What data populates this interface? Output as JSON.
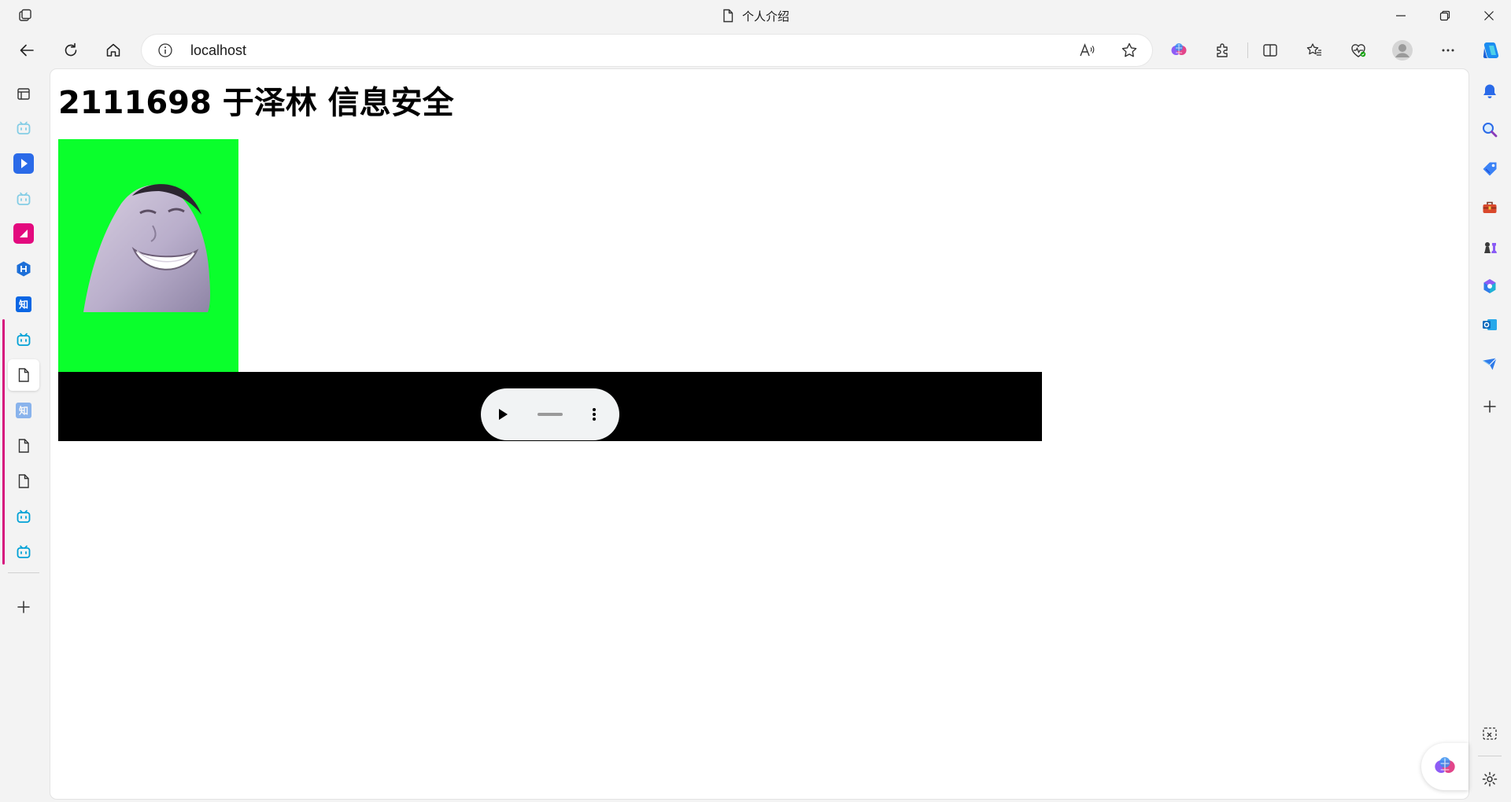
{
  "window": {
    "title": "个人介绍"
  },
  "address_bar": {
    "url": "localhost"
  },
  "page": {
    "heading": "2111698 于泽林 信息安全"
  },
  "audio_player": {
    "progress": 0
  },
  "colors": {
    "accent_pink": "#d6127d",
    "bilibili_blue": "#00a1d6",
    "image_green": "#0aff2c",
    "copilot_blue": "#1c8cf0"
  },
  "icons": {
    "left_sidebar": [
      "workspaces-icon",
      "bilibili-icon",
      "video-app-icon",
      "bilibili-icon",
      "pink-app-icon",
      "h-app-icon",
      "zhihu-icon",
      "bilibili-icon",
      "page-icon",
      "zhihu-icon",
      "page-icon",
      "page-icon",
      "bilibili-icon",
      "bilibili-icon",
      "add-icon"
    ],
    "right_sidebar": [
      "bell-icon",
      "search-icon",
      "tag-icon",
      "toolbox-icon",
      "chess-icon",
      "copilot-365-icon",
      "outlook-icon",
      "send-icon",
      "add-icon",
      "screenshot-icon",
      "settings-icon"
    ]
  }
}
